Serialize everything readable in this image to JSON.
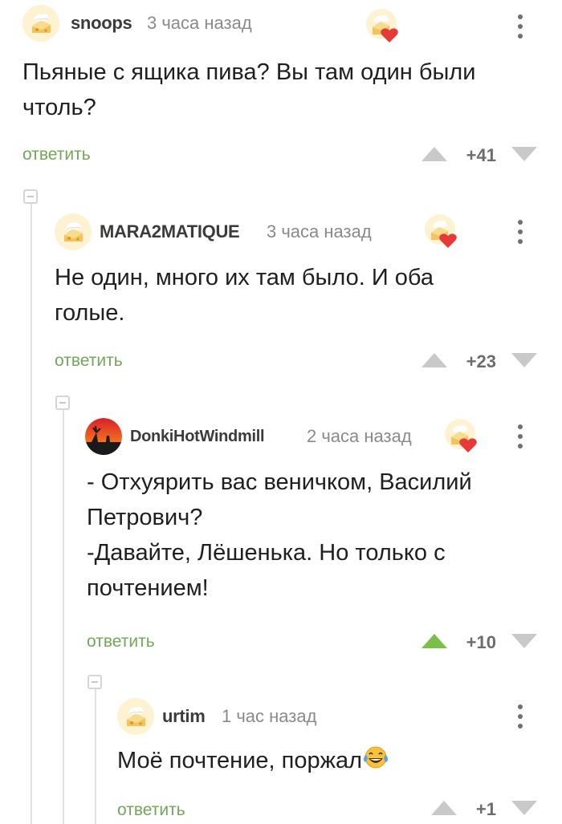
{
  "comments": [
    {
      "username": "snoops",
      "time": "3 часа назад",
      "text_lines": [
        "Пьяные с ящика пива? Вы там один были",
        "чтоль?"
      ],
      "reply_label": "ответить",
      "score": "+41",
      "upvoted": false
    },
    {
      "username": "MARA2MATIQUE",
      "time": "3 часа назад",
      "text_lines": [
        "Не один, много их там было. И оба",
        "голые."
      ],
      "reply_label": "ответить",
      "score": "+23",
      "upvoted": false
    },
    {
      "username": "DonkiHotWindmill",
      "time": "2 часа назад",
      "text_lines": [
        "- Отхуярить вас веничком, Василий",
        "Петрович?",
        "-Давайте, Лёшенька. Но только с",
        "почтением!"
      ],
      "reply_label": "ответить",
      "score": "+10",
      "upvoted": true
    },
    {
      "username": "urtim",
      "time": "1 час назад",
      "text_lines": [
        "Моё почтение, поржал"
      ],
      "reply_label": "ответить",
      "score": "+1",
      "upvoted": false
    }
  ],
  "colors": {
    "reply_green": "#74a659",
    "vote_grey": "#c9c9c9",
    "vote_active": "#7bbf4a",
    "heart_red": "#e5393a"
  },
  "icons": {
    "avatar": "default-cheese-avatar-icon",
    "badge": "cheese-heart-badge-icon",
    "more": "more-vertical-icon",
    "emoji": "laughing-tears-emoji-icon"
  }
}
